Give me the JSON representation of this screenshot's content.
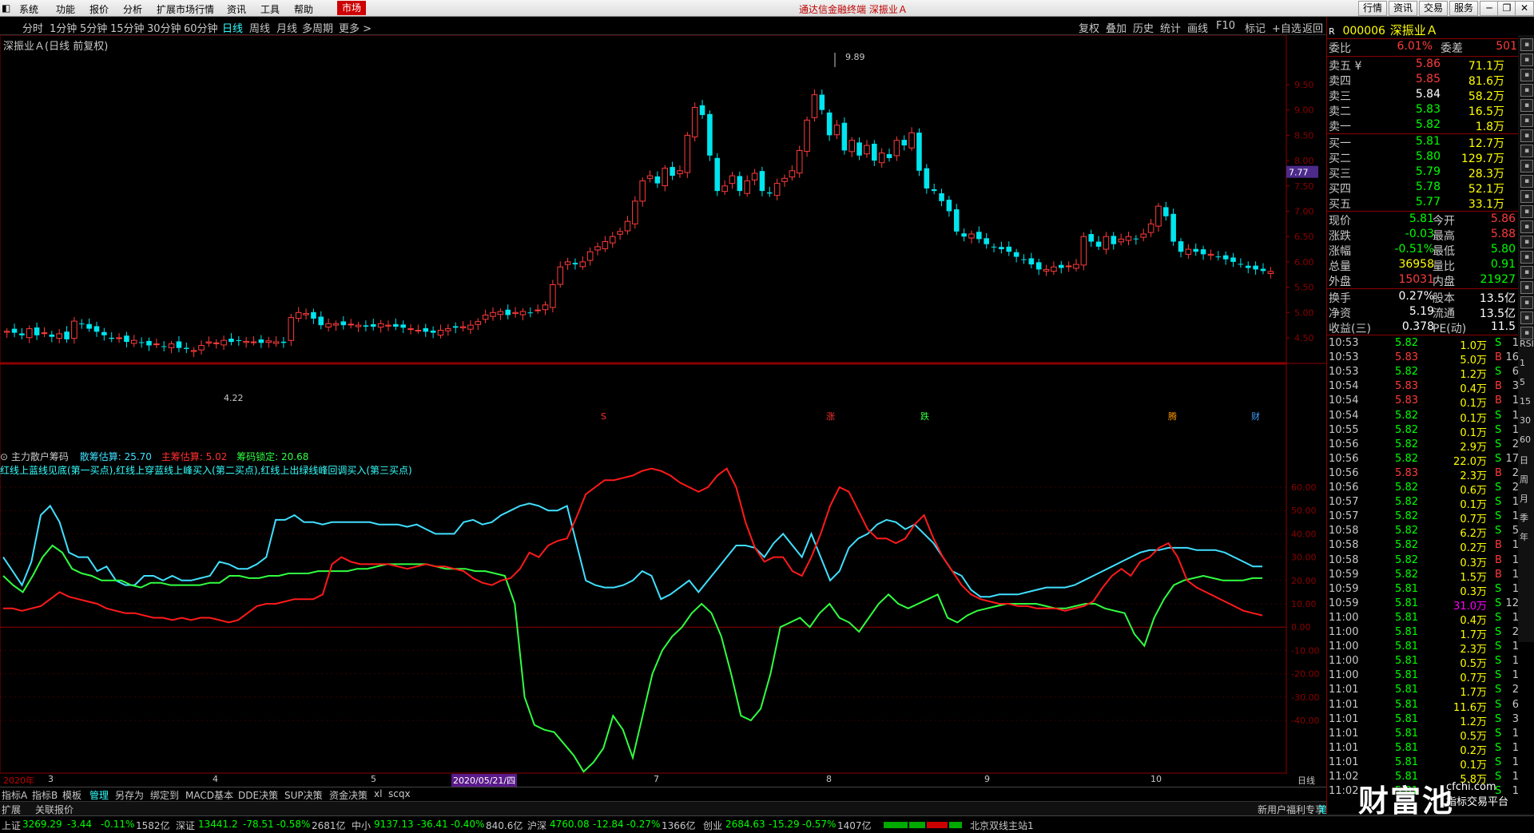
{
  "menu": {
    "items": [
      "系统",
      "功能",
      "报价",
      "分析",
      "扩展市场行情",
      "资讯",
      "工具",
      "帮助"
    ],
    "market_label": "市场",
    "app_title": "通达信金融终端  深振业Ａ",
    "right_buttons": [
      "行情",
      "资讯",
      "交易",
      "服务"
    ]
  },
  "periods": {
    "items": [
      "分时",
      "1分钟",
      "5分钟",
      "15分钟",
      "30分钟",
      "60分钟",
      "日线",
      "周线",
      "月线",
      "多周期",
      "更多 >"
    ],
    "active": "日线",
    "right_tools": [
      "复权",
      "叠加",
      "历史",
      "统计",
      "画线",
      "F10",
      "标记",
      "+自选",
      "返回"
    ]
  },
  "chart_title": "深振业Ａ(日线 前复权)",
  "price_axis": [
    "9.50",
    "9.00",
    "8.50",
    "8.00",
    "7.50",
    "7.00",
    "6.50",
    "6.00",
    "5.50",
    "5.00",
    "4.50"
  ],
  "high_label": "9.89",
  "low_label": "4.22",
  "current_tag": "7.77",
  "event_marks": [
    "S",
    "涨",
    "跌",
    "腾",
    "财"
  ],
  "indicator": {
    "name": "主力散户筹码",
    "v1_label": "散筹估算: 25.70",
    "v2_label": "主筹估算: 5.02",
    "v3_label": "筹码锁定: 20.68",
    "desc": "红线上蓝线见底(第一买点),红线上穿蓝线上峰买入(第二买点),红线上出绿线峰回调买入(第三买点)",
    "axis": [
      "60.00",
      "50.00",
      "40.00",
      "30.00",
      "20.00",
      "10.00",
      "0.00",
      "-10.00",
      "-20.00",
      "-30.00",
      "-40.00"
    ]
  },
  "date_axis": {
    "labels": [
      "2020年",
      "3",
      "4",
      "5",
      "2020/05/21/四",
      "7",
      "8",
      "9",
      "10"
    ],
    "period_label": "日线"
  },
  "bottom_tabs": [
    "指标A",
    "指标B",
    "模板",
    "管理",
    "另存为",
    "绑定到",
    "MACD基本",
    "DDE决策",
    "SUP决策",
    "资金决策",
    "xl",
    "scqx"
  ],
  "bottom_active": "管理",
  "ext_tabs": [
    "扩展",
    "关联报价"
  ],
  "ext_right": [
    "新用户福利专享",
    "笔"
  ],
  "stock": {
    "code": "000006",
    "name": "深振业Ａ",
    "r": "R"
  },
  "order_ratio": {
    "label1": "委比",
    "v1": "6.01%",
    "label2": "委差",
    "v2": "501"
  },
  "sell": [
    {
      "label": "卖五 ¥",
      "price": "5.86",
      "vol": "71.1万"
    },
    {
      "label": "卖四",
      "price": "5.85",
      "vol": "81.6万"
    },
    {
      "label": "卖三",
      "price": "5.84",
      "vol": "58.2万"
    },
    {
      "label": "卖二",
      "price": "5.83",
      "vol": "16.5万"
    },
    {
      "label": "卖一",
      "price": "5.82",
      "vol": "1.8万"
    }
  ],
  "buy": [
    {
      "label": "买一",
      "price": "5.81",
      "vol": "12.7万"
    },
    {
      "label": "买二",
      "price": "5.80",
      "vol": "129.7万"
    },
    {
      "label": "买三",
      "price": "5.79",
      "vol": "28.3万"
    },
    {
      "label": "买四",
      "price": "5.78",
      "vol": "52.1万"
    },
    {
      "label": "买五",
      "price": "5.77",
      "vol": "33.1万"
    }
  ],
  "quote": [
    {
      "l1": "现价",
      "v1": "5.81",
      "l2": "今开",
      "v2": "5.86"
    },
    {
      "l1": "涨跌",
      "v1": "-0.03",
      "l2": "最高",
      "v2": "5.88"
    },
    {
      "l1": "涨幅",
      "v1": "-0.51%",
      "l2": "最低",
      "v2": "5.80"
    },
    {
      "l1": "总量",
      "v1": "36958",
      "l2": "量比",
      "v2": "0.91"
    },
    {
      "l1": "外盘",
      "v1": "15031",
      "l2": "内盘",
      "v2": "21927"
    }
  ],
  "fund": [
    {
      "l1": "换手",
      "v1": "0.27%",
      "l2": "股本",
      "v2": "13.5亿"
    },
    {
      "l1": "净资",
      "v1": "5.19",
      "l2": "流通",
      "v2": "13.5亿"
    },
    {
      "l1": "收益(三)",
      "v1": "0.378",
      "l2": "PE(动)",
      "v2": "11.5"
    }
  ],
  "ticks": [
    {
      "t": "10:53",
      "p": "5.82",
      "v": "1.0万",
      "s": "S",
      "n": "1"
    },
    {
      "t": "10:53",
      "p": "5.83",
      "v": "5.0万",
      "s": "B",
      "n": "16"
    },
    {
      "t": "10:53",
      "p": "5.82",
      "v": "1.2万",
      "s": "S",
      "n": "6"
    },
    {
      "t": "10:54",
      "p": "5.83",
      "v": "0.4万",
      "s": "B",
      "n": "3"
    },
    {
      "t": "10:54",
      "p": "5.83",
      "v": "0.1万",
      "s": "B",
      "n": "1"
    },
    {
      "t": "10:54",
      "p": "5.82",
      "v": "0.1万",
      "s": "S",
      "n": "1"
    },
    {
      "t": "10:55",
      "p": "5.82",
      "v": "0.1万",
      "s": "S",
      "n": "1"
    },
    {
      "t": "10:56",
      "p": "5.82",
      "v": "2.9万",
      "s": "S",
      "n": "2"
    },
    {
      "t": "10:56",
      "p": "5.82",
      "v": "22.0万",
      "s": "S",
      "n": "17"
    },
    {
      "t": "10:56",
      "p": "5.83",
      "v": "2.3万",
      "s": "B",
      "n": "2"
    },
    {
      "t": "10:56",
      "p": "5.82",
      "v": "0.6万",
      "s": "S",
      "n": "2"
    },
    {
      "t": "10:57",
      "p": "5.82",
      "v": "0.1万",
      "s": "S",
      "n": "1"
    },
    {
      "t": "10:57",
      "p": "5.82",
      "v": "0.7万",
      "s": "S",
      "n": "1"
    },
    {
      "t": "10:58",
      "p": "5.82",
      "v": "6.2万",
      "s": "S",
      "n": "5"
    },
    {
      "t": "10:58",
      "p": "5.82",
      "v": "0.2万",
      "s": "B",
      "n": "1"
    },
    {
      "t": "10:58",
      "p": "5.82",
      "v": "0.3万",
      "s": "B",
      "n": "1"
    },
    {
      "t": "10:59",
      "p": "5.82",
      "v": "1.5万",
      "s": "B",
      "n": "1"
    },
    {
      "t": "10:59",
      "p": "5.81",
      "v": "0.3万",
      "s": "S",
      "n": "1"
    },
    {
      "t": "10:59",
      "p": "5.81",
      "v": "31.0万",
      "s": "S",
      "n": "12"
    },
    {
      "t": "11:00",
      "p": "5.81",
      "v": "0.4万",
      "s": "S",
      "n": "1"
    },
    {
      "t": "11:00",
      "p": "5.81",
      "v": "1.7万",
      "s": "S",
      "n": "2"
    },
    {
      "t": "11:00",
      "p": "5.81",
      "v": "2.3万",
      "s": "S",
      "n": "1"
    },
    {
      "t": "11:00",
      "p": "5.81",
      "v": "0.5万",
      "s": "S",
      "n": "1"
    },
    {
      "t": "11:00",
      "p": "5.81",
      "v": "0.7万",
      "s": "S",
      "n": "1"
    },
    {
      "t": "11:01",
      "p": "5.81",
      "v": "1.7万",
      "s": "S",
      "n": "2"
    },
    {
      "t": "11:01",
      "p": "5.81",
      "v": "11.6万",
      "s": "S",
      "n": "6"
    },
    {
      "t": "11:01",
      "p": "5.81",
      "v": "1.2万",
      "s": "S",
      "n": "3"
    },
    {
      "t": "11:01",
      "p": "5.81",
      "v": "0.5万",
      "s": "S",
      "n": "1"
    },
    {
      "t": "11:01",
      "p": "5.81",
      "v": "0.2万",
      "s": "S",
      "n": "1"
    },
    {
      "t": "11:01",
      "p": "5.81",
      "v": "0.1万",
      "s": "S",
      "n": "1"
    },
    {
      "t": "11:02",
      "p": "5.81",
      "v": "5.8万",
      "s": "S",
      "n": "1"
    },
    {
      "t": "11:02",
      "p": "5.81",
      "v": "",
      "s": "S",
      "n": "1"
    }
  ],
  "icon_labels": [
    "RSI",
    "1",
    "5",
    "15",
    "30",
    "60",
    "日",
    "周",
    "月",
    "季",
    "年"
  ],
  "status": [
    {
      "name": "上证",
      "price": "3269.29",
      "chg": "-3.44",
      "pct": "-0.11%",
      "amt": "1582亿"
    },
    {
      "name": "深证",
      "price": "13441.2",
      "chg": "-78.51",
      "pct": "-0.58%",
      "amt": "2681亿"
    },
    {
      "name": "中小",
      "price": "9137.13",
      "chg": "-36.41",
      "pct": "-0.40%",
      "amt": "840.6亿"
    },
    {
      "name": "沪深",
      "price": "4760.08",
      "chg": "-12.84",
      "pct": "-0.27%",
      "amt": "1366亿"
    },
    {
      "name": "创业",
      "price": "2684.63",
      "chg": "-15.29",
      "pct": "-0.57%",
      "amt": "1407亿"
    }
  ],
  "server": "北京双线主站1",
  "logo_text": "财富池",
  "logo_site": "cfchi.com",
  "logo_sub": "指标交易平台",
  "colors": {
    "up": "#ff3b3b",
    "down": "#00e5ee",
    "cyan": "#3ff",
    "red_line": "#ff1a1a",
    "blue_line": "#40e0ff",
    "green_line": "#30ff40"
  }
}
